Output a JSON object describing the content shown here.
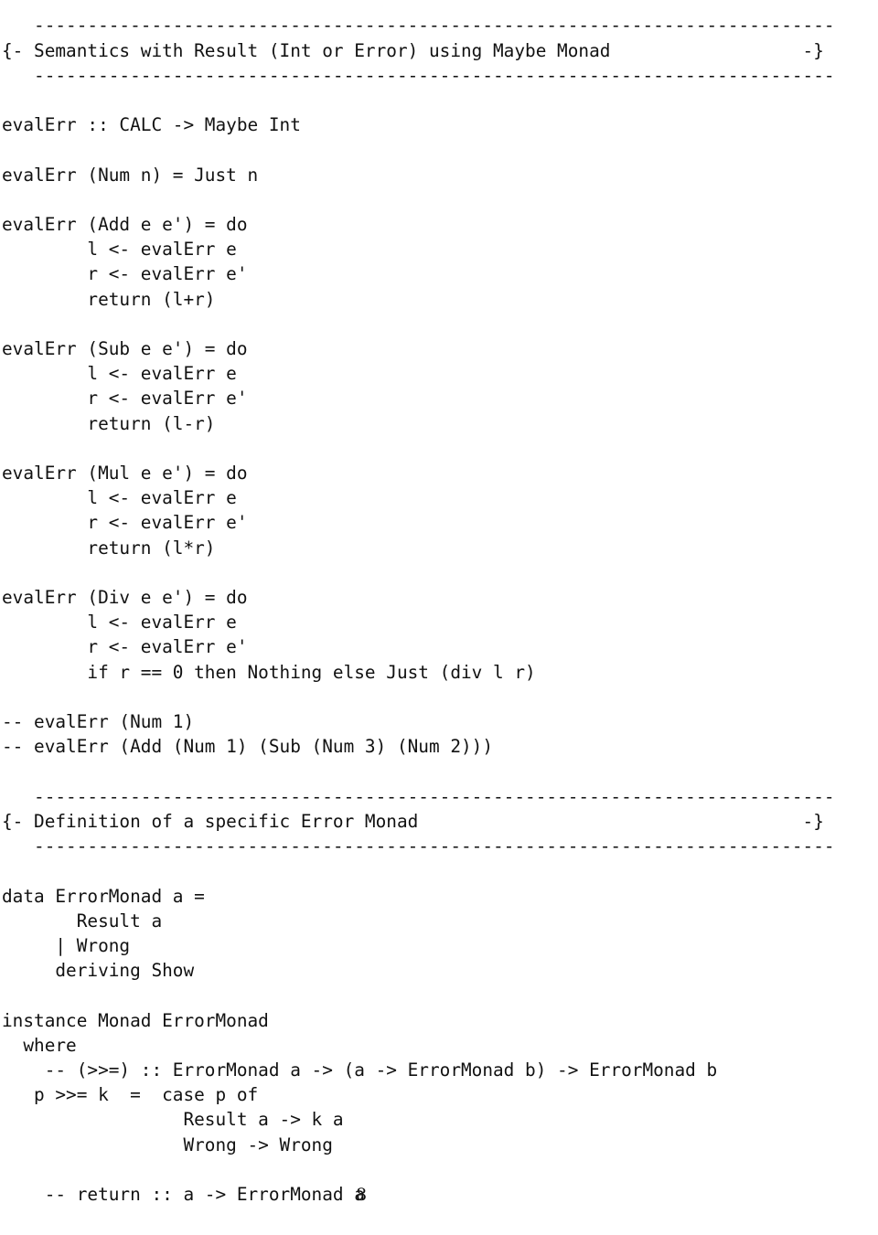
{
  "document": {
    "kind": "haskell-source-listing",
    "page_number": "8",
    "language": "Haskell",
    "sections": [
      {
        "name": "maybe-monad-semantics",
        "banner": {
          "rule_top": "   ---------------------------------------------------------------------------",
          "title_line": "{- Semantics with Result (Int or Error) using Maybe Monad                  -}",
          "rule_bottom": "   ---------------------------------------------------------------------------",
          "title_text": "Semantics with Result (Int or Error) using Maybe Monad",
          "open_delimiter": "{-",
          "close_delimiter": "-}"
        }
      },
      {
        "name": "error-monad-definition",
        "banner": {
          "rule_top": "   ---------------------------------------------------------------------------",
          "title_line": "{- Definition of a specific Error Monad                                    -}",
          "rule_bottom": "   ---------------------------------------------------------------------------",
          "title_text": "Definition of a specific Error Monad",
          "open_delimiter": "{-",
          "close_delimiter": "-}"
        }
      }
    ],
    "lines": [
      "   ---------------------------------------------------------------------------",
      "{- Semantics with Result (Int or Error) using Maybe Monad                  -}",
      "   ---------------------------------------------------------------------------",
      "",
      "evalErr :: CALC -> Maybe Int",
      "",
      "evalErr (Num n) = Just n",
      "",
      "evalErr (Add e e') = do",
      "        l <- evalErr e",
      "        r <- evalErr e'",
      "        return (l+r)",
      "",
      "evalErr (Sub e e') = do",
      "        l <- evalErr e",
      "        r <- evalErr e'",
      "        return (l-r)",
      "",
      "evalErr (Mul e e') = do",
      "        l <- evalErr e",
      "        r <- evalErr e'",
      "        return (l*r)",
      "",
      "evalErr (Div e e') = do",
      "        l <- evalErr e",
      "        r <- evalErr e'",
      "        if r == 0 then Nothing else Just (div l r)",
      "",
      "-- evalErr (Num 1)",
      "-- evalErr (Add (Num 1) (Sub (Num 3) (Num 2)))",
      "",
      "   ---------------------------------------------------------------------------",
      "{- Definition of a specific Error Monad                                    -}",
      "   ---------------------------------------------------------------------------",
      "",
      "data ErrorMonad a =",
      "       Result a",
      "     | Wrong",
      "     deriving Show",
      "",
      "instance Monad ErrorMonad",
      "  where",
      "    -- (>>=) :: ErrorMonad a -> (a -> ErrorMonad b) -> ErrorMonad b",
      "   p >>= k  =  case p of",
      "                 Result a -> k a",
      "                 Wrong -> Wrong",
      "",
      "    -- return :: a -> ErrorMonad a"
    ]
  }
}
